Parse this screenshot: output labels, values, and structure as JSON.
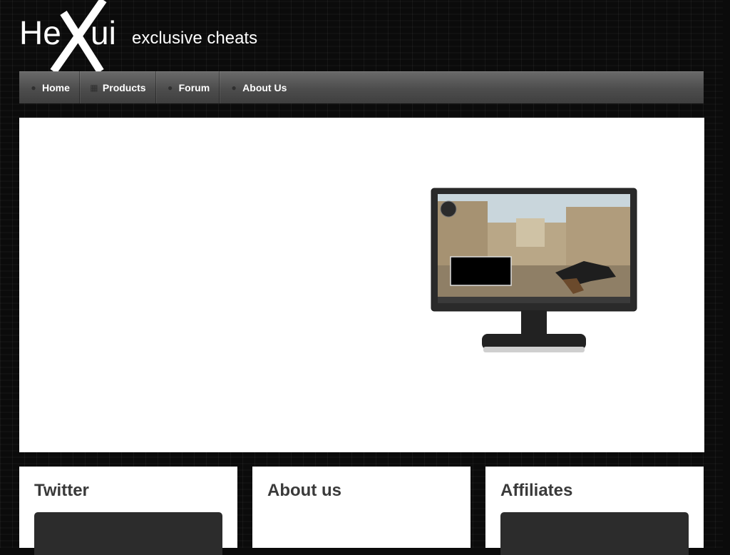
{
  "site": {
    "logo_text": "HeXui",
    "tagline": "exclusive cheats"
  },
  "nav": {
    "items": [
      {
        "label": "Home",
        "icon": "globe-icon"
      },
      {
        "label": "Products",
        "icon": "grid-icon"
      },
      {
        "label": "Forum",
        "icon": "chat-icon"
      },
      {
        "label": "About Us",
        "icon": "info-icon"
      }
    ]
  },
  "hero": {
    "image": "monitor-screenshot-image"
  },
  "cards": {
    "twitter_title": "Twitter",
    "about_title": "About us",
    "affiliates_title": "Affiliates"
  },
  "colors": {
    "background": "#0b0b0b",
    "nav_bar": "#4d4d4d",
    "panel": "#ffffff",
    "heading": "#3a3a3a",
    "widget": "#2c2c2c"
  }
}
